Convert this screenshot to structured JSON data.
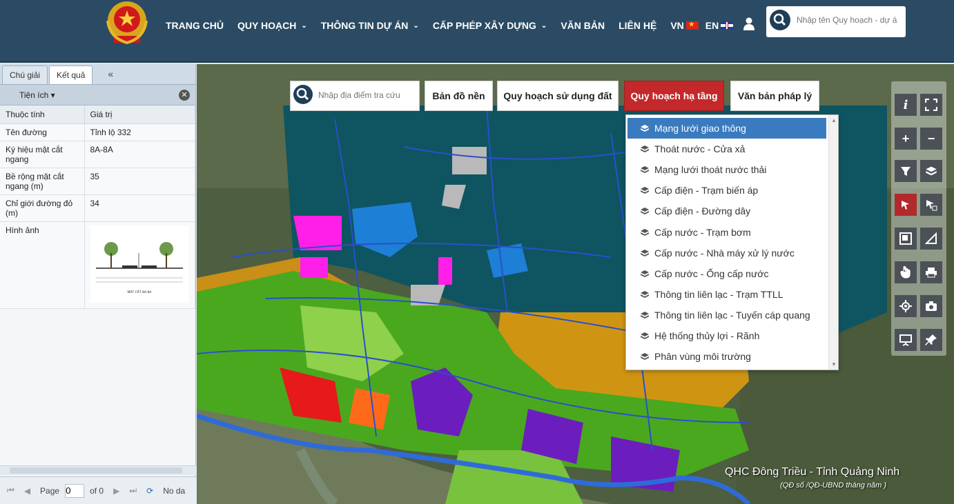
{
  "header": {
    "nav": [
      {
        "label": "TRANG CHỦ",
        "has_dropdown": false
      },
      {
        "label": "QUY HOẠCH",
        "has_dropdown": true
      },
      {
        "label": "THÔNG TIN DỰ ÁN",
        "has_dropdown": true
      },
      {
        "label": "CẤP PHÉP XÂY DỰNG",
        "has_dropdown": true
      },
      {
        "label": "VĂN BẢN",
        "has_dropdown": false
      },
      {
        "label": "LIÊN HỆ",
        "has_dropdown": false
      }
    ],
    "lang_vn": "VN",
    "lang_en": "EN",
    "search_placeholder": "Nhập tên Quy hoạch - dự á"
  },
  "left_panel": {
    "tabs": [
      "Chú giải",
      "Kết quả"
    ],
    "active_tab": "Kết quả",
    "collapse_symbol": "«",
    "section_label": "Tiện ích",
    "table_headers": [
      "Thuộc tính",
      "Giá trị"
    ],
    "rows": [
      {
        "attr": "Tên đường",
        "value": "Tỉnh lộ 332"
      },
      {
        "attr": "Ký hiệu mặt cắt ngang",
        "value": "8A-8A"
      },
      {
        "attr": "Bề rộng mặt cắt ngang (m)",
        "value": "35"
      },
      {
        "attr": "Chỉ giới đường đỏ (m)",
        "value": "34"
      },
      {
        "attr": "Hình ảnh",
        "value": ""
      }
    ],
    "image_caption": "MẶT CẮT 8A-8A",
    "pager": {
      "page_label": "Page",
      "page_value": "0",
      "of_label": "of 0",
      "no_data": "No da"
    }
  },
  "map": {
    "search_placeholder": "Nhập địa điểm tra cứu",
    "buttons": [
      "Bản đồ nền",
      "Quy hoạch sử dụng đất",
      "Quy hoạch hạ tầng",
      "Văn bản pháp lý"
    ],
    "active_button": "Quy hoạch hạ tầng",
    "dropdown_items": [
      "Mạng lưới giao thông",
      "Thoát nước - Cửa xả",
      "Mạng lưới thoát nước thải",
      "Cấp điện - Trạm biến áp",
      "Cấp điện - Đường dây",
      "Cấp nước - Trạm bơm",
      "Cấp nước - Nhà máy xử lý nước",
      "Cấp nước - Ống cấp nước",
      "Thông tin liên lạc - Trạm TTLL",
      "Thông tin liên lạc - Tuyến cáp quang",
      "Hệ thống thủy lợi - Rãnh",
      "Phân vùng môi trường"
    ],
    "selected_item": "Mạng lưới giao thông",
    "watermark": "QHC Đông Triều - Tỉnh Quảng Ninh",
    "watermark_sub": "(QĐ số /QĐ-UBND tháng năm )",
    "tools": [
      "info-icon",
      "fullscreen-icon",
      "zoom-in-icon",
      "zoom-out-icon",
      "filter-icon",
      "layers-icon",
      "select-point-icon",
      "select-area-icon",
      "overview-icon",
      "measure-icon",
      "pan-icon",
      "print-icon",
      "locate-icon",
      "screenshot-icon",
      "presentation-icon",
      "pin-icon"
    ],
    "colors": {
      "active": "#c3282a",
      "selected": "#3a7bbf",
      "header": "#2a4b63"
    }
  }
}
